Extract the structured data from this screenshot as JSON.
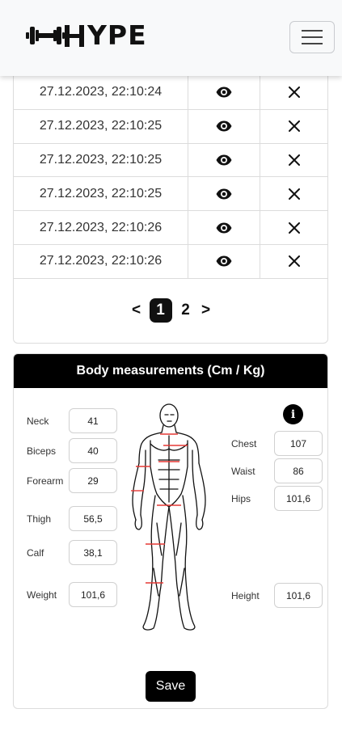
{
  "navbar": {
    "logo_text": "YPE",
    "logo_icon": "dumbbell-icon",
    "menu_icon": "hamburger-icon"
  },
  "history": {
    "rows": [
      {
        "date": "27.12.2023, 22:10:24",
        "view_icon": "eye-icon",
        "delete_icon": "close-icon"
      },
      {
        "date": "27.12.2023, 22:10:25",
        "view_icon": "eye-icon",
        "delete_icon": "close-icon"
      },
      {
        "date": "27.12.2023, 22:10:25",
        "view_icon": "eye-icon",
        "delete_icon": "close-icon"
      },
      {
        "date": "27.12.2023, 22:10:25",
        "view_icon": "eye-icon",
        "delete_icon": "close-icon"
      },
      {
        "date": "27.12.2023, 22:10:26",
        "view_icon": "eye-icon",
        "delete_icon": "close-icon"
      },
      {
        "date": "27.12.2023, 22:10:26",
        "view_icon": "eye-icon",
        "delete_icon": "close-icon"
      }
    ]
  },
  "pagination": {
    "prev": "<",
    "pages": [
      "1",
      "2"
    ],
    "active": "1",
    "next": ">"
  },
  "measurements": {
    "title": "Body measurements (Cm / Kg)",
    "info_icon": "info-icon",
    "neck": {
      "label": "Neck",
      "value": "41"
    },
    "biceps": {
      "label": "Biceps",
      "value": "40"
    },
    "forearm": {
      "label": "Forearm",
      "value": "29"
    },
    "thigh": {
      "label": "Thigh",
      "value": "56,5"
    },
    "calf": {
      "label": "Calf",
      "value": "38,1"
    },
    "weight": {
      "label": "Weight",
      "value": "101,6"
    },
    "chest": {
      "label": "Chest",
      "value": "107"
    },
    "waist": {
      "label": "Waist",
      "value": "86"
    },
    "hips": {
      "label": "Hips",
      "value": "101,6"
    },
    "height": {
      "label": "Height",
      "value": "101,6"
    },
    "save_label": "Save",
    "marker_color": "#e53935"
  },
  "colors": {
    "primary": "#000000",
    "navbar_bg": "#f8f9fa",
    "border": "#dcdcdc"
  }
}
